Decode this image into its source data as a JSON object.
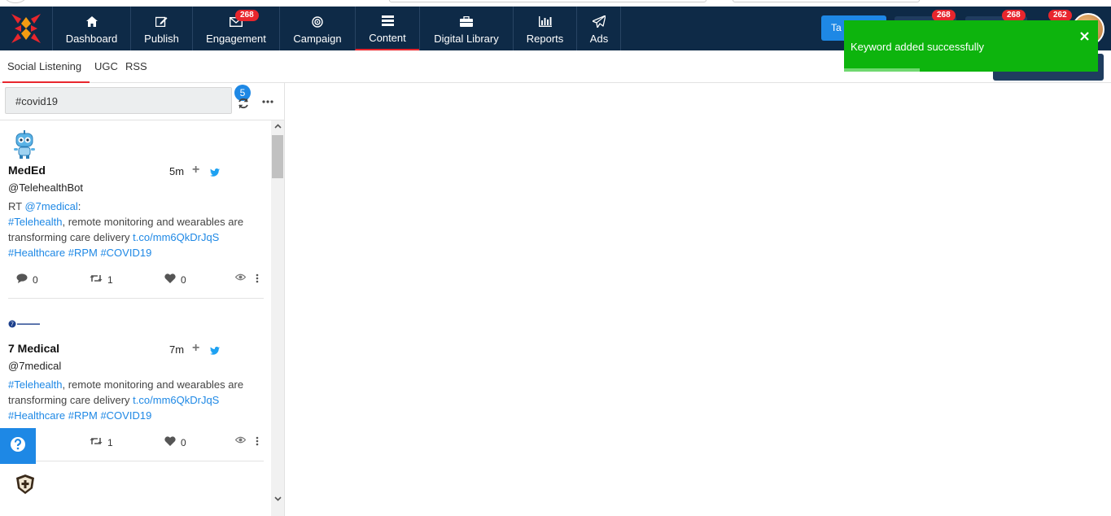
{
  "nav": {
    "items": [
      {
        "label": "Dashboard",
        "icon": "home-icon"
      },
      {
        "label": "Publish",
        "icon": "edit-icon"
      },
      {
        "label": "Engagement",
        "icon": "envelope-icon",
        "badge": "268"
      },
      {
        "label": "Campaign",
        "icon": "bullseye-icon"
      },
      {
        "label": "Content",
        "icon": "list-icon",
        "active": true
      },
      {
        "label": "Digital Library",
        "icon": "briefcase-icon"
      },
      {
        "label": "Reports",
        "icon": "bar-chart-icon"
      },
      {
        "label": "Ads",
        "icon": "paper-plane-icon"
      }
    ],
    "take_button_label": "Ta",
    "header_badges": [
      "268",
      "268",
      "262"
    ]
  },
  "subnav": {
    "tabs": [
      "Social Listening",
      "UGC",
      "RSS"
    ]
  },
  "panel": {
    "search_value": "#covid19",
    "count": "5"
  },
  "posts": [
    {
      "name": "MedEd",
      "handle": "@TelehealthBot",
      "time": "5m",
      "rt": "RT ",
      "mention": "@7medical",
      "mention_suffix": ":",
      "hashtag1": "#Telehealth",
      "text": ", remote monitoring and wearables are transforming care delivery ",
      "link": "t.co/mm6QkDrJqS",
      "tags": "#Healthcare #RPM #COVID19",
      "comments": "0",
      "retweets": "1",
      "likes": "0"
    },
    {
      "name": "7 Medical",
      "handle": "@7medical",
      "time": "7m",
      "hashtag1": "#Telehealth",
      "text": ", remote monitoring and wearables are transforming care delivery ",
      "link": "t.co/mm6QkDrJqS",
      "tags": "#Healthcare #RPM #COVID19",
      "retweets": "1",
      "likes": "0"
    }
  ],
  "toast": {
    "message": "Keyword added successfully"
  },
  "colors": {
    "navbar": "#0e2a47",
    "accent": "#e8262d",
    "link": "#1e88e5",
    "toast": "#0db40d"
  }
}
